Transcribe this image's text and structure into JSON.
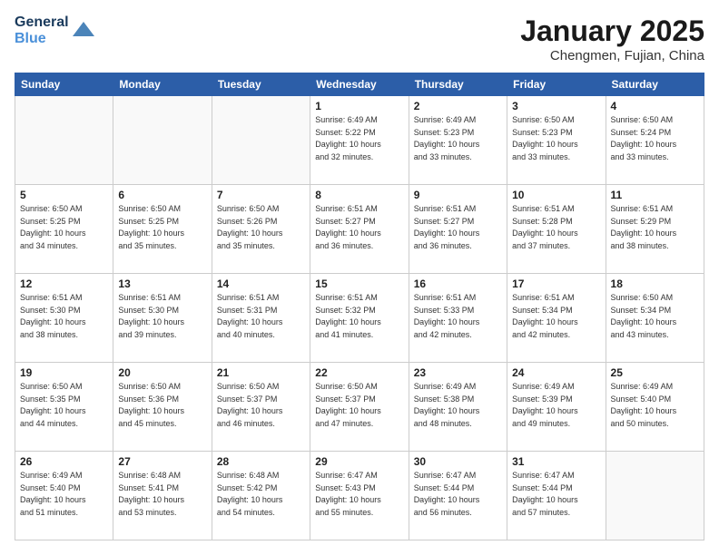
{
  "logo": {
    "line1": "General",
    "line2": "Blue"
  },
  "title": "January 2025",
  "location": "Chengmen, Fujian, China",
  "weekdays": [
    "Sunday",
    "Monday",
    "Tuesday",
    "Wednesday",
    "Thursday",
    "Friday",
    "Saturday"
  ],
  "weeks": [
    [
      {
        "day": "",
        "info": ""
      },
      {
        "day": "",
        "info": ""
      },
      {
        "day": "",
        "info": ""
      },
      {
        "day": "1",
        "info": "Sunrise: 6:49 AM\nSunset: 5:22 PM\nDaylight: 10 hours\nand 32 minutes."
      },
      {
        "day": "2",
        "info": "Sunrise: 6:49 AM\nSunset: 5:23 PM\nDaylight: 10 hours\nand 33 minutes."
      },
      {
        "day": "3",
        "info": "Sunrise: 6:50 AM\nSunset: 5:23 PM\nDaylight: 10 hours\nand 33 minutes."
      },
      {
        "day": "4",
        "info": "Sunrise: 6:50 AM\nSunset: 5:24 PM\nDaylight: 10 hours\nand 33 minutes."
      }
    ],
    [
      {
        "day": "5",
        "info": "Sunrise: 6:50 AM\nSunset: 5:25 PM\nDaylight: 10 hours\nand 34 minutes."
      },
      {
        "day": "6",
        "info": "Sunrise: 6:50 AM\nSunset: 5:25 PM\nDaylight: 10 hours\nand 35 minutes."
      },
      {
        "day": "7",
        "info": "Sunrise: 6:50 AM\nSunset: 5:26 PM\nDaylight: 10 hours\nand 35 minutes."
      },
      {
        "day": "8",
        "info": "Sunrise: 6:51 AM\nSunset: 5:27 PM\nDaylight: 10 hours\nand 36 minutes."
      },
      {
        "day": "9",
        "info": "Sunrise: 6:51 AM\nSunset: 5:27 PM\nDaylight: 10 hours\nand 36 minutes."
      },
      {
        "day": "10",
        "info": "Sunrise: 6:51 AM\nSunset: 5:28 PM\nDaylight: 10 hours\nand 37 minutes."
      },
      {
        "day": "11",
        "info": "Sunrise: 6:51 AM\nSunset: 5:29 PM\nDaylight: 10 hours\nand 38 minutes."
      }
    ],
    [
      {
        "day": "12",
        "info": "Sunrise: 6:51 AM\nSunset: 5:30 PM\nDaylight: 10 hours\nand 38 minutes."
      },
      {
        "day": "13",
        "info": "Sunrise: 6:51 AM\nSunset: 5:30 PM\nDaylight: 10 hours\nand 39 minutes."
      },
      {
        "day": "14",
        "info": "Sunrise: 6:51 AM\nSunset: 5:31 PM\nDaylight: 10 hours\nand 40 minutes."
      },
      {
        "day": "15",
        "info": "Sunrise: 6:51 AM\nSunset: 5:32 PM\nDaylight: 10 hours\nand 41 minutes."
      },
      {
        "day": "16",
        "info": "Sunrise: 6:51 AM\nSunset: 5:33 PM\nDaylight: 10 hours\nand 42 minutes."
      },
      {
        "day": "17",
        "info": "Sunrise: 6:51 AM\nSunset: 5:34 PM\nDaylight: 10 hours\nand 42 minutes."
      },
      {
        "day": "18",
        "info": "Sunrise: 6:50 AM\nSunset: 5:34 PM\nDaylight: 10 hours\nand 43 minutes."
      }
    ],
    [
      {
        "day": "19",
        "info": "Sunrise: 6:50 AM\nSunset: 5:35 PM\nDaylight: 10 hours\nand 44 minutes."
      },
      {
        "day": "20",
        "info": "Sunrise: 6:50 AM\nSunset: 5:36 PM\nDaylight: 10 hours\nand 45 minutes."
      },
      {
        "day": "21",
        "info": "Sunrise: 6:50 AM\nSunset: 5:37 PM\nDaylight: 10 hours\nand 46 minutes."
      },
      {
        "day": "22",
        "info": "Sunrise: 6:50 AM\nSunset: 5:37 PM\nDaylight: 10 hours\nand 47 minutes."
      },
      {
        "day": "23",
        "info": "Sunrise: 6:49 AM\nSunset: 5:38 PM\nDaylight: 10 hours\nand 48 minutes."
      },
      {
        "day": "24",
        "info": "Sunrise: 6:49 AM\nSunset: 5:39 PM\nDaylight: 10 hours\nand 49 minutes."
      },
      {
        "day": "25",
        "info": "Sunrise: 6:49 AM\nSunset: 5:40 PM\nDaylight: 10 hours\nand 50 minutes."
      }
    ],
    [
      {
        "day": "26",
        "info": "Sunrise: 6:49 AM\nSunset: 5:40 PM\nDaylight: 10 hours\nand 51 minutes."
      },
      {
        "day": "27",
        "info": "Sunrise: 6:48 AM\nSunset: 5:41 PM\nDaylight: 10 hours\nand 53 minutes."
      },
      {
        "day": "28",
        "info": "Sunrise: 6:48 AM\nSunset: 5:42 PM\nDaylight: 10 hours\nand 54 minutes."
      },
      {
        "day": "29",
        "info": "Sunrise: 6:47 AM\nSunset: 5:43 PM\nDaylight: 10 hours\nand 55 minutes."
      },
      {
        "day": "30",
        "info": "Sunrise: 6:47 AM\nSunset: 5:44 PM\nDaylight: 10 hours\nand 56 minutes."
      },
      {
        "day": "31",
        "info": "Sunrise: 6:47 AM\nSunset: 5:44 PM\nDaylight: 10 hours\nand 57 minutes."
      },
      {
        "day": "",
        "info": ""
      }
    ]
  ]
}
